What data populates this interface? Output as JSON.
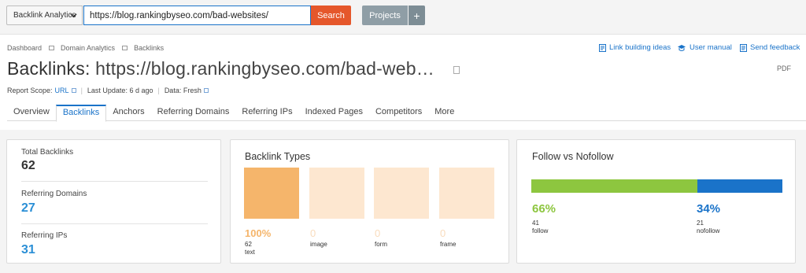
{
  "topbar": {
    "database_label": "Backlink Analytics",
    "url_value": "https://blog.rankingbyseo.com/bad-websites/",
    "search_label": "Search",
    "projects_label": "Projects",
    "projects_add": "+"
  },
  "breadcrumb": [
    "Dashboard",
    "Domain Analytics",
    "Backlinks"
  ],
  "top_links": {
    "link_building": "Link building ideas",
    "user_manual": "User manual",
    "send_feedback": "Send feedback"
  },
  "header": {
    "title_prefix": "Backlinks:",
    "title_url": "https://blog.rankingbyseo.com/bad-web…",
    "pdf_label": "PDF"
  },
  "meta": {
    "scope_label": "Report Scope:",
    "scope_value": "URL",
    "last_update": "Last Update: 6 d ago",
    "data_label": "Data: Fresh"
  },
  "tabs": [
    "Overview",
    "Backlinks",
    "Anchors",
    "Referring Domains",
    "Referring IPs",
    "Indexed Pages",
    "Competitors",
    "More"
  ],
  "summary": {
    "total_backlinks_label": "Total Backlinks",
    "total_backlinks": "62",
    "referring_domains_label": "Referring Domains",
    "referring_domains": "27",
    "referring_ips_label": "Referring IPs",
    "referring_ips": "31"
  },
  "backlink_types": {
    "title": "Backlink Types",
    "items": [
      {
        "pct": "100%",
        "count": "62",
        "name": "text"
      },
      {
        "pct": "0",
        "count": "",
        "name": "image"
      },
      {
        "pct": "0",
        "count": "",
        "name": "form"
      },
      {
        "pct": "0",
        "count": "",
        "name": "frame"
      }
    ]
  },
  "follow": {
    "title": "Follow vs Nofollow",
    "follow_pct": "66%",
    "follow_count": "41",
    "follow_label": "follow",
    "nofollow_pct": "34%",
    "nofollow_count": "21",
    "nofollow_label": "nofollow",
    "follow_share": 0.66
  },
  "colors": {
    "accent": "#1a73c9",
    "search": "#e5572b",
    "orange": "#f5b56b",
    "orange_light": "#fde7d0",
    "green": "#8dc63f",
    "blue": "#1a73c9",
    "value_blue": "#2b8fd6"
  }
}
